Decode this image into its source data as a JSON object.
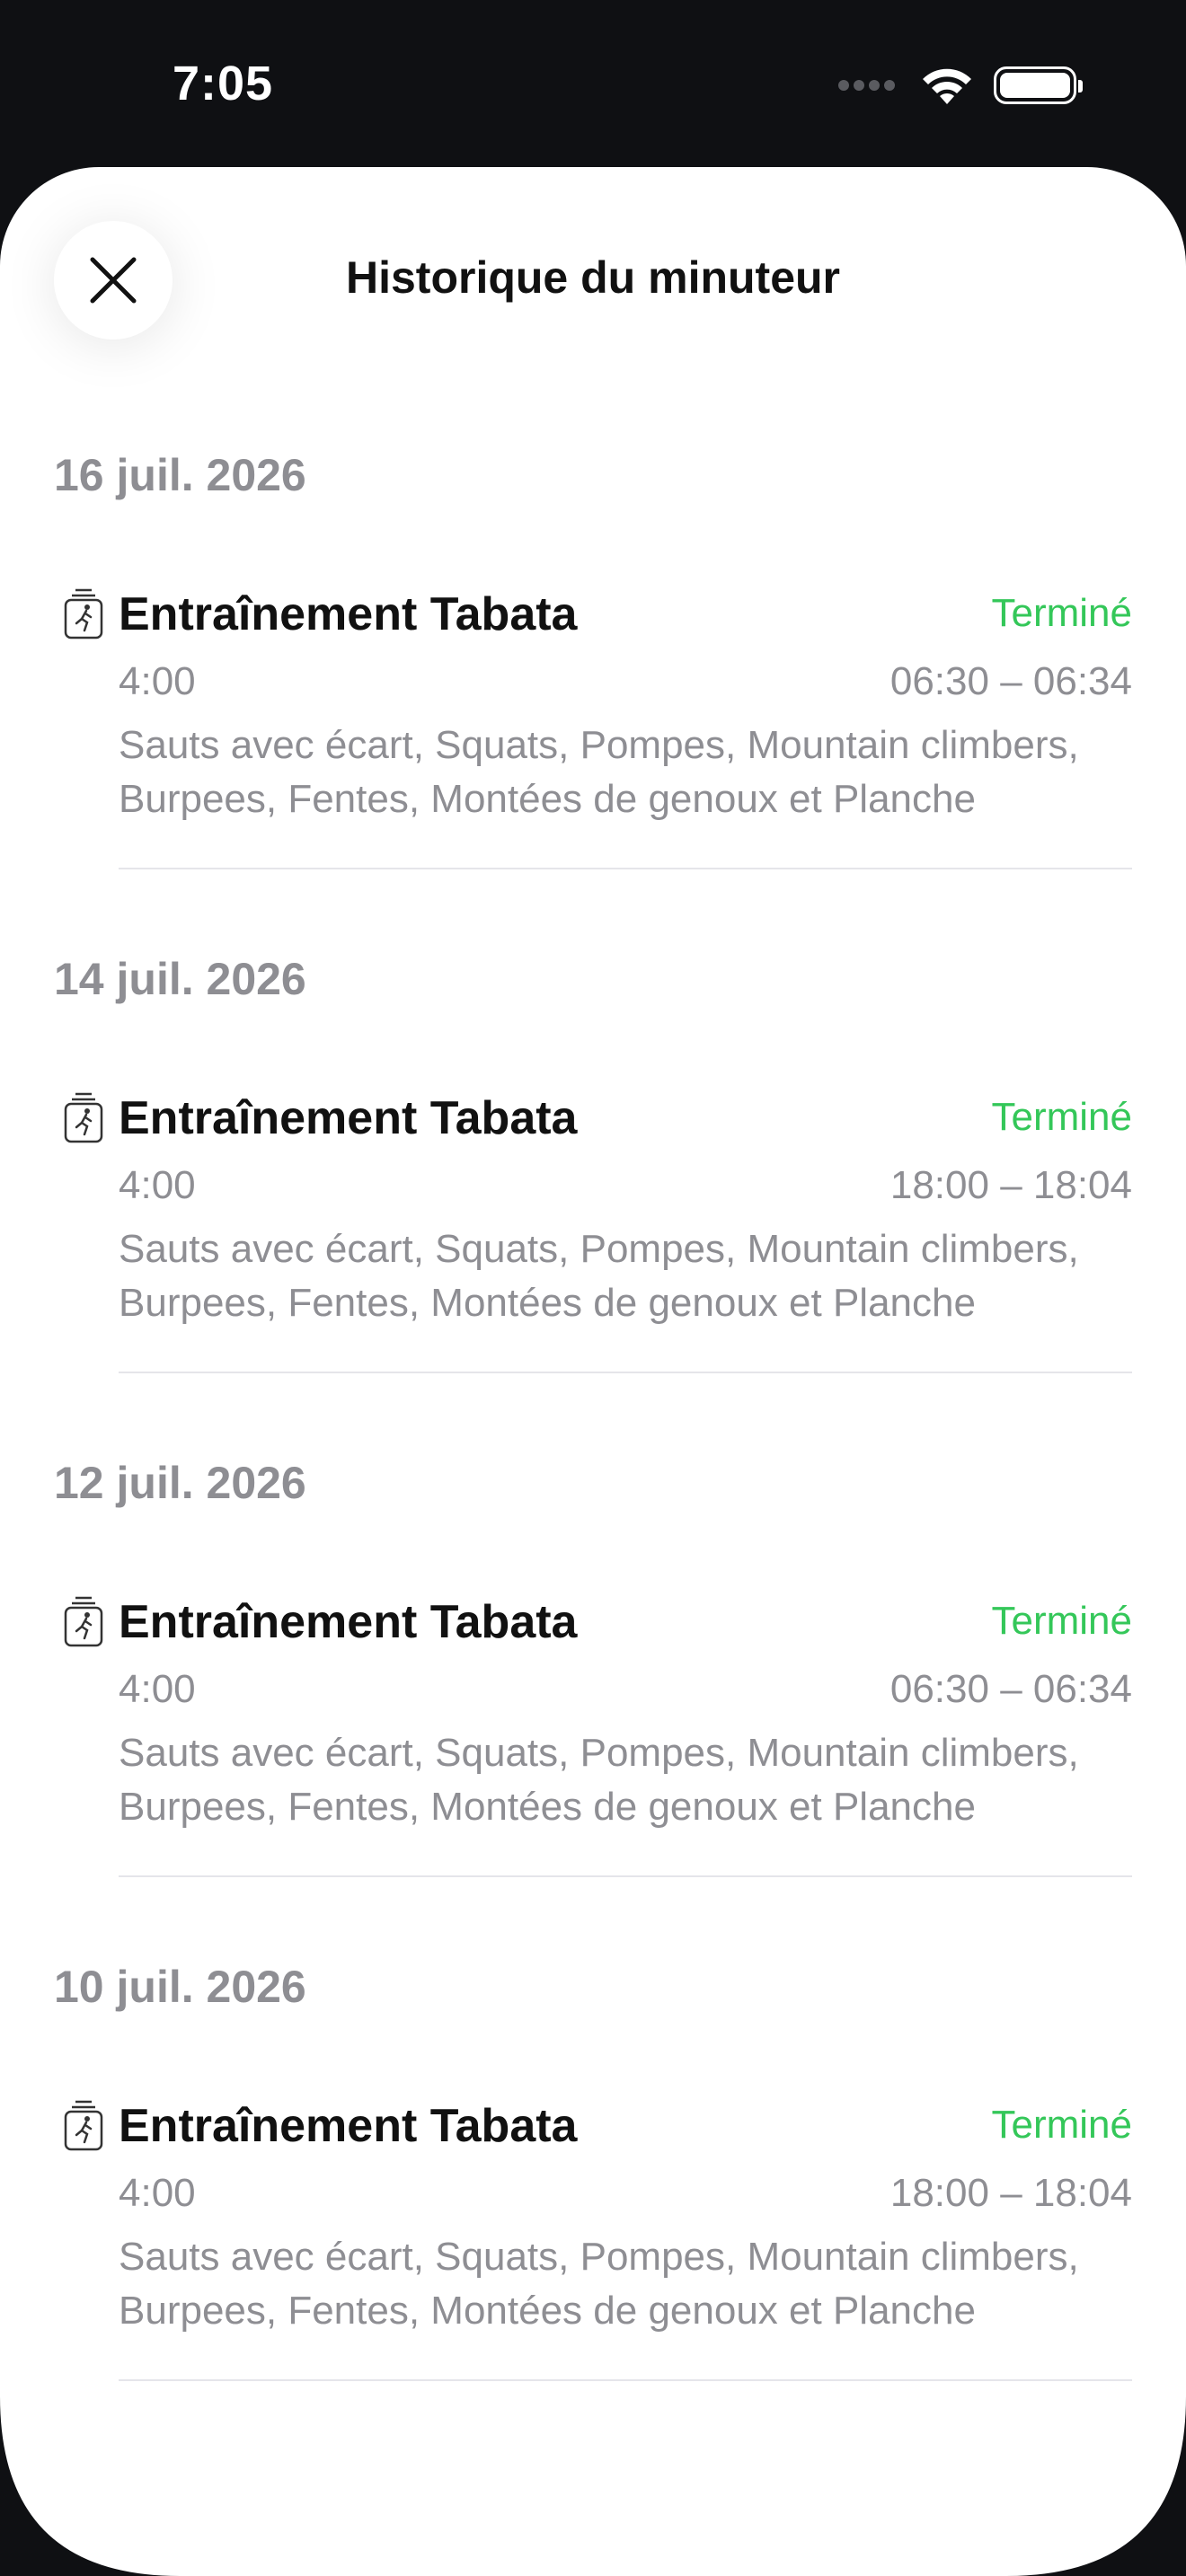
{
  "status_bar": {
    "time": "7:05",
    "icons": [
      "cellular-signal-icon",
      "wifi-icon",
      "battery-icon"
    ]
  },
  "header": {
    "title": "Historique du minuteur",
    "close_icon": "close-icon"
  },
  "colors": {
    "status_completed": "#34c759",
    "secondary_text": "#8e8e93",
    "primary_text": "#111111"
  },
  "sessions": [
    {
      "date": "16 juil. 2026",
      "icon": "timer-workout-icon",
      "title": "Entraînement Tabata",
      "status": "Terminé",
      "duration": "4:00",
      "time_range": "06:30 – 06:34",
      "exercises": "Sauts avec écart, Squats, Pompes, Mountain climbers, Burpees, Fentes, Montées de genoux et Planche"
    },
    {
      "date": "14 juil. 2026",
      "icon": "timer-workout-icon",
      "title": "Entraînement Tabata",
      "status": "Terminé",
      "duration": "4:00",
      "time_range": "18:00 – 18:04",
      "exercises": "Sauts avec écart, Squats, Pompes, Mountain climbers, Burpees, Fentes, Montées de genoux et Planche"
    },
    {
      "date": "12 juil. 2026",
      "icon": "timer-workout-icon",
      "title": "Entraînement Tabata",
      "status": "Terminé",
      "duration": "4:00",
      "time_range": "06:30 – 06:34",
      "exercises": "Sauts avec écart, Squats, Pompes, Mountain climbers, Burpees, Fentes, Montées de genoux et Planche"
    },
    {
      "date": "10 juil. 2026",
      "icon": "timer-workout-icon",
      "title": "Entraînement Tabata",
      "status": "Terminé",
      "duration": "4:00",
      "time_range": "18:00 – 18:04",
      "exercises": "Sauts avec écart, Squats, Pompes, Mountain climbers, Burpees, Fentes, Montées de genoux et Planche"
    }
  ]
}
